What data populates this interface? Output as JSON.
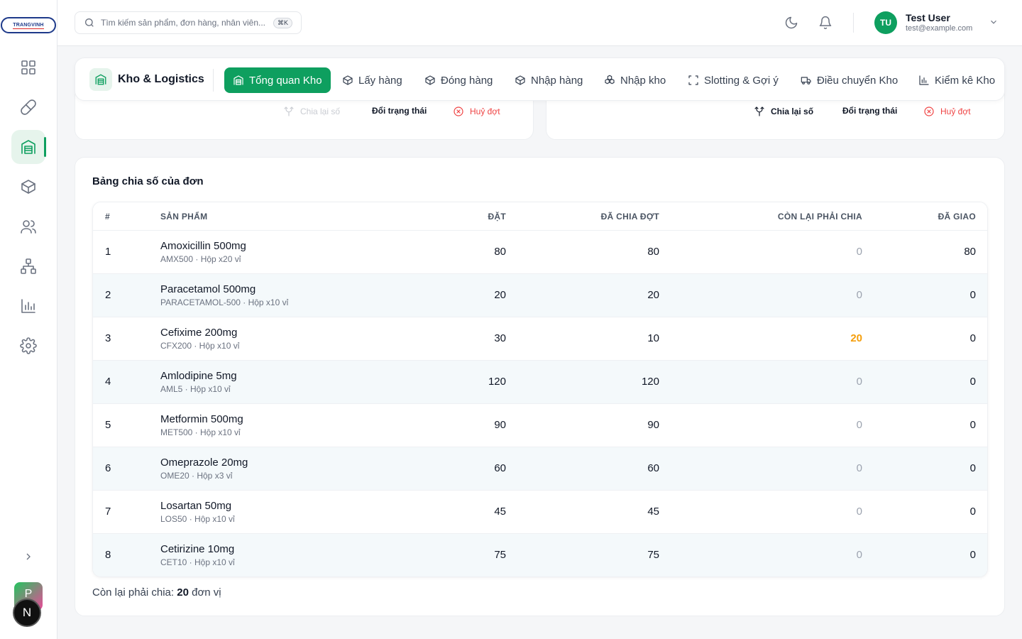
{
  "brand": {
    "logo_text": "TRANGVINH"
  },
  "search": {
    "placeholder": "Tìm kiếm sản phẩm, đơn hàng, nhân viên...",
    "shortcut": "⌘K"
  },
  "user": {
    "initials": "TU",
    "name": "Test User",
    "email": "test@example.com"
  },
  "sidebar": {
    "items": [
      {
        "icon": "dashboard-icon"
      },
      {
        "icon": "pill-icon"
      },
      {
        "icon": "warehouse-icon",
        "active": true
      },
      {
        "icon": "package-icon"
      },
      {
        "icon": "users-icon"
      },
      {
        "icon": "org-chart-icon"
      },
      {
        "icon": "bar-chart-icon"
      },
      {
        "icon": "gear-icon"
      }
    ],
    "badge_p": "P",
    "badge_n": "N"
  },
  "module": {
    "title": "Kho & Logistics"
  },
  "tabs": [
    {
      "label": "Tổng quan Kho",
      "icon": "warehouse-icon",
      "active": true
    },
    {
      "label": "Lấy hàng",
      "icon": "box-icon"
    },
    {
      "label": "Đóng hàng",
      "icon": "box-icon"
    },
    {
      "label": "Nhập hàng",
      "icon": "box-icon"
    },
    {
      "label": "Nhập kho",
      "icon": "boxes-icon"
    },
    {
      "label": "Slotting & Gợi ý",
      "icon": "scan-icon"
    },
    {
      "label": "Điều chuyển Kho",
      "icon": "truck-icon"
    },
    {
      "label": "Kiểm kê Kho",
      "icon": "chart-icon"
    }
  ],
  "batch_left": {
    "split_again": "Chia lại số",
    "change_status": "Đổi trạng thái",
    "cancel": "Huỷ đợt"
  },
  "batch_right": {
    "split_again": "Chia lại số",
    "change_status": "Đổi trạng thái",
    "cancel": "Huỷ đợt"
  },
  "allocation": {
    "title": "Bảng chia số của đơn",
    "headers": {
      "idx": "#",
      "product": "SẢN PHẨM",
      "ordered": "ĐẶT",
      "allocated": "ĐÃ CHIA ĐỢT",
      "remaining": "CÒN LẠI PHẢI CHIA",
      "delivered": "ĐÃ GIAO"
    },
    "rows": [
      {
        "idx": "1",
        "name": "Amoxicillin 500mg",
        "sub": "AMX500 · Hộp x20 vỉ",
        "ordered": "80",
        "allocated": "80",
        "remaining": "0",
        "delivered": "80"
      },
      {
        "idx": "2",
        "name": "Paracetamol 500mg",
        "sub": "PARACETAMOL-500 · Hộp x10 vỉ",
        "ordered": "20",
        "allocated": "20",
        "remaining": "0",
        "delivered": "0"
      },
      {
        "idx": "3",
        "name": "Cefixime 200mg",
        "sub": "CFX200 · Hộp x10 vỉ",
        "ordered": "30",
        "allocated": "10",
        "remaining": "20",
        "delivered": "0",
        "highlight": true
      },
      {
        "idx": "4",
        "name": "Amlodipine 5mg",
        "sub": "AML5 · Hộp x10 vỉ",
        "ordered": "120",
        "allocated": "120",
        "remaining": "0",
        "delivered": "0"
      },
      {
        "idx": "5",
        "name": "Metformin 500mg",
        "sub": "MET500 · Hộp x10 vỉ",
        "ordered": "90",
        "allocated": "90",
        "remaining": "0",
        "delivered": "0"
      },
      {
        "idx": "6",
        "name": "Omeprazole 20mg",
        "sub": "OME20 · Hộp x3 vỉ",
        "ordered": "60",
        "allocated": "60",
        "remaining": "0",
        "delivered": "0"
      },
      {
        "idx": "7",
        "name": "Losartan 50mg",
        "sub": "LOS50 · Hộp x10 vỉ",
        "ordered": "45",
        "allocated": "45",
        "remaining": "0",
        "delivered": "0"
      },
      {
        "idx": "8",
        "name": "Cetirizine 10mg",
        "sub": "CET10 · Hộp x10 vỉ",
        "ordered": "75",
        "allocated": "75",
        "remaining": "0",
        "delivered": "0"
      }
    ],
    "summary_prefix": "Còn lại phải chia: ",
    "summary_value": "20",
    "summary_suffix": " đơn vị"
  },
  "colors": {
    "accent": "#0e9f5f",
    "warning": "#f59e0b",
    "danger": "#ef4444",
    "muted_zero": "#9ca3af"
  }
}
